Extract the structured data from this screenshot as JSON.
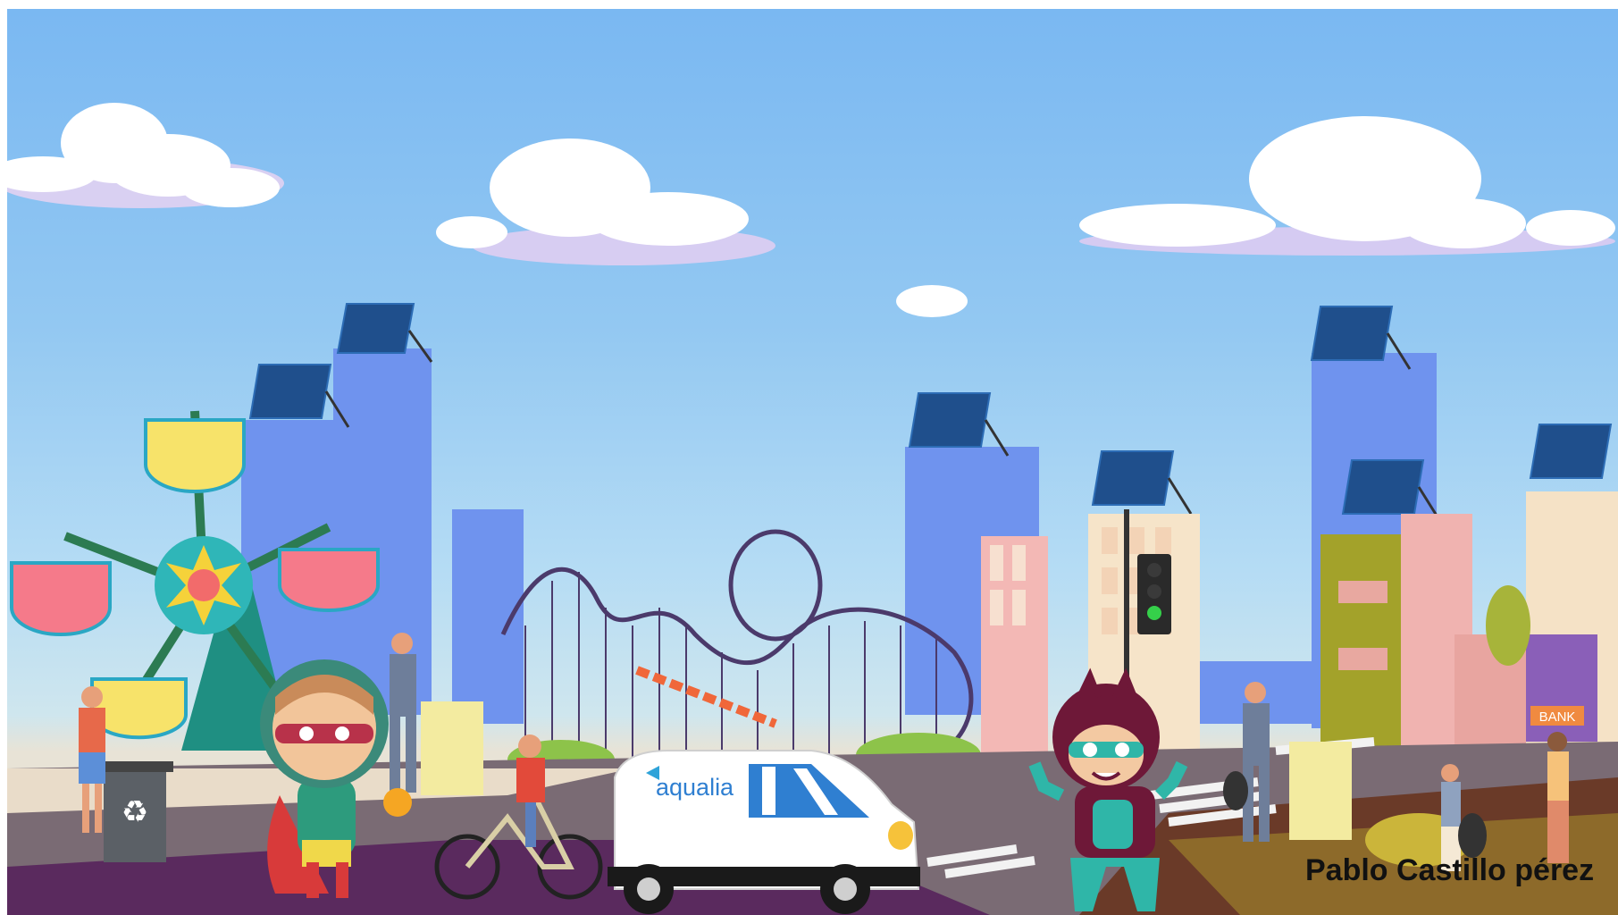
{
  "illustration": {
    "van_logo": "aqualia",
    "bank_sign": "BANK",
    "recycle_symbol": "♻",
    "credit": "Pablo Castillo pérez"
  },
  "colors": {
    "sky_top": "#7ab8f2",
    "building_blue": "#6f93ee",
    "road": "#6e6572",
    "purple_ground": "#5a2a5e",
    "van_blue": "#2f7fd1",
    "hero_green": "#2d9b7d",
    "hero_maroon": "#6e1838"
  }
}
